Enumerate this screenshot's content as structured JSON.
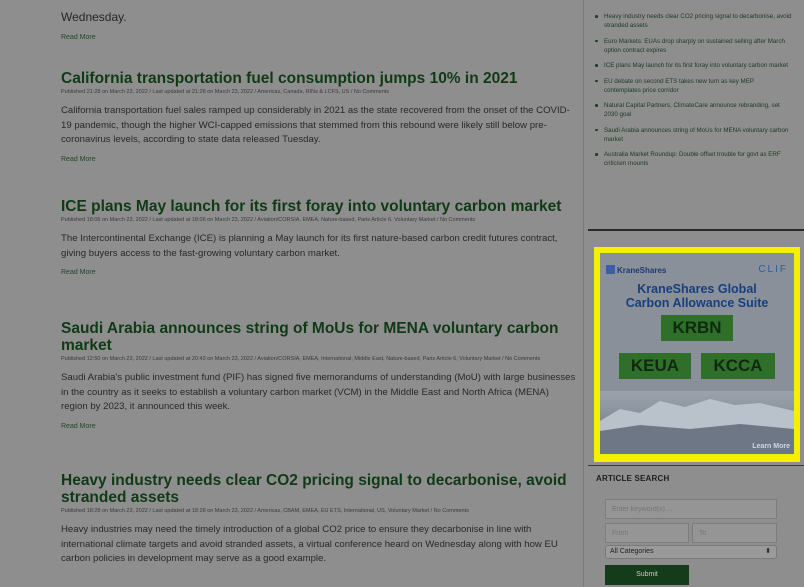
{
  "fragment": {
    "text": "Wednesday.",
    "read_more": "Read More"
  },
  "articles": [
    {
      "title": "California transportation fuel consumption jumps 10% in 2021",
      "meta": "Published 21:28 on March 23, 2022  /  Last updated at 21:28 on March 23, 2022  /  Americas, Canada, RINs & LCFS, US  /  No Comments",
      "body": "California transportation fuel sales ramped up considerably in 2021 as the state recovered from the onset of the COVID-19 pandemic, though the higher WCI-capped emissions that stemmed from this rebound were likely still below pre-coronavirus levels, according to state data released Tuesday.",
      "read_more": "Read More"
    },
    {
      "title": "ICE plans May launch for its first foray into voluntary carbon market",
      "meta": "Published 18:06 on March 23, 2022  /  Last updated at 18:06 on March 23, 2022  /  Aviation/CORSIA, EMEA, Nature-based, Paris Article 6, Voluntary Market  /  No Comments",
      "body": "The Intercontinental Exchange (ICE) is planning a May launch for its first nature-based carbon credit futures contract, giving buyers access to the fast-growing voluntary carbon market.",
      "read_more": "Read More"
    },
    {
      "title": "Saudi Arabia announces string of MoUs for MENA voluntary carbon market",
      "meta": "Published 12:50 on March 23, 2022  /  Last updated at 20:43 on March 23, 2022  /  Aviation/CORSIA, EMEA, International, Middle East, Nature-based, Paris Article 6, Voluntary Market  /  No Comments",
      "body": "Saudi Arabia's public investment fund (PIF) has signed five memorandums of understanding (MoU) with large businesses in the country as it seeks to establish a voluntary carbon market (VCM) in the Middle East and North Africa (MENA) region by 2023, it announced this week.",
      "read_more": "Read More"
    },
    {
      "title": "Heavy industry needs clear CO2 pricing signal to decarbonise, avoid stranded assets",
      "meta": "Published 18:28 on March 23, 2022  /  Last updated at 18:28 on March 23, 2022  /  Americas, CBAM, EMEA, EU ETS, International, US, Voluntary Market  /  No Comments",
      "body": "Heavy industries may need the timely introduction of a global CO2 price to ensure they decarbonise in line with international climate targets and avoid stranded assets, a virtual conference heard on Wednesday along with how EU carbon policies in development may serve as a good example."
    }
  ],
  "sidebar_news": [
    "Heavy industry needs clear CO2 pricing signal to decarbonise, avoid stranded assets",
    "Euro Markets: EUAs drop sharply on sustained selling after March option contract expires",
    "ICE plans May launch for its first foray into voluntary carbon market",
    "EU debate on second ETS takes new turn as key MEP contemplates price corridor",
    "Natural Capital Partners, ClimateCare announce rebranding, set 2030 goal",
    "Saudi Arabia announces string of MoUs for MENA voluntary carbon market",
    "Australia Market Roundup: Double offset trouble for govt as ERF criticism mounts"
  ],
  "ad": {
    "brand": "KraneShares",
    "clif": "CLIF",
    "title_line1": "KraneShares Global",
    "title_line2": "Carbon Allowance Suite",
    "tickers": [
      "KRBN",
      "KEUA",
      "KCCA"
    ],
    "learn_more": "Learn More",
    "highlight_color": "#f6ef00"
  },
  "search": {
    "heading": "ARTICLE SEARCH",
    "keyword_placeholder": "Enter keyword(s) ...",
    "from_placeholder": "From",
    "to_placeholder": "To",
    "category_selected": "All Categories",
    "submit_label": "Submit"
  }
}
